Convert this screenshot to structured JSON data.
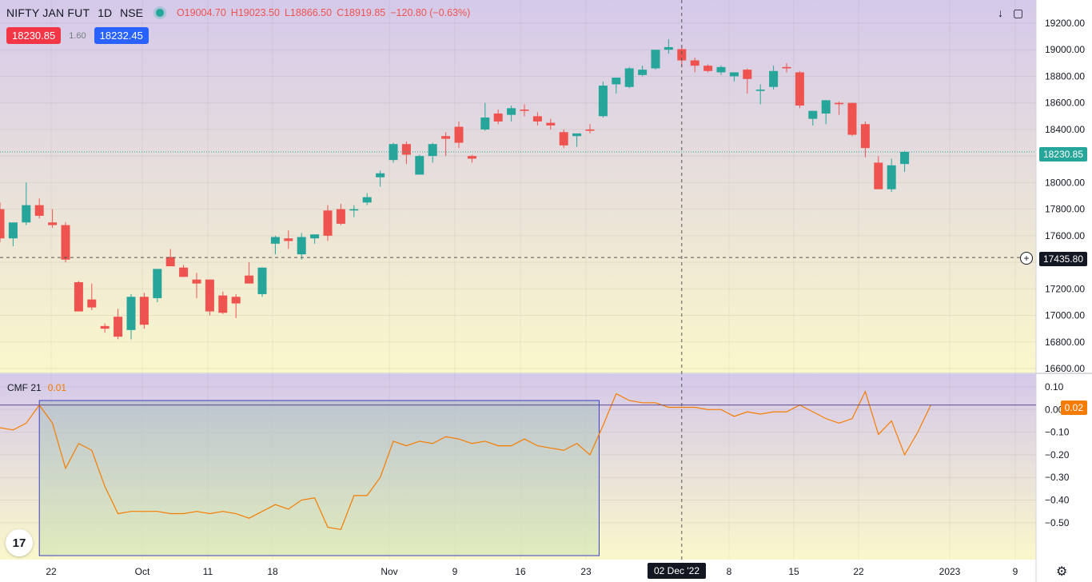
{
  "header": {
    "symbol": "NIFTY JAN FUT",
    "interval": "1D",
    "exchange": "NSE",
    "ohlc": {
      "o": "O19004.70",
      "h": "H19023.50",
      "l": "L18866.50",
      "c": "C18919.85",
      "chg": "−120.80 (−0.63%)"
    }
  },
  "quotes": {
    "sell": "18230.85",
    "spread": "1.60",
    "buy": "18232.45"
  },
  "icons": [
    "download-arrow-icon",
    "fullscreen-icon"
  ],
  "indicator": {
    "name": "CMF 21",
    "value": "0.01"
  },
  "price_tags": {
    "last": "18230.85",
    "crosshair": "17435.80",
    "cmf": "0.02"
  },
  "crosshair_date": "02 Dec '22",
  "logo_text": "17",
  "colors": {
    "up": "#26a69a",
    "down": "#ef5350",
    "cmf_line": "#f57c00",
    "selection": "#3f3fbf"
  },
  "chart_data": [
    {
      "type": "candlestick",
      "price_scale": {
        "min": 16600,
        "max": 19200,
        "ticks": [
          "19200.00",
          "19000.00",
          "18800.00",
          "18600.00",
          "18400.00",
          "18200.00",
          "18000.00",
          "17800.00",
          "17600.00",
          "17400.00",
          "17200.00",
          "17000.00",
          "16800.00",
          "16600.00"
        ]
      },
      "time_labels": [
        "22",
        "Oct",
        "11",
        "18",
        "Nov",
        "9",
        "16",
        "23",
        "8",
        "15",
        "22",
        "2023",
        "9"
      ],
      "last_price": 18230.85,
      "crosshair_price": 17435.8,
      "candles": [
        [
          17800,
          17850,
          17550,
          17580
        ],
        [
          17580,
          17680,
          17520,
          17700
        ],
        [
          17700,
          18000,
          17680,
          17830
        ],
        [
          17830,
          17880,
          17730,
          17750
        ],
        [
          17700,
          17800,
          17660,
          17680
        ],
        [
          17680,
          17700,
          17400,
          17420
        ],
        [
          17250,
          17260,
          17040,
          17030
        ],
        [
          17120,
          17240,
          17040,
          17060
        ],
        [
          16920,
          16940,
          16870,
          16900
        ],
        [
          16990,
          17050,
          16820,
          16840
        ],
        [
          16890,
          17160,
          16820,
          17140
        ],
        [
          17140,
          17170,
          16900,
          16930
        ],
        [
          17130,
          17200,
          17100,
          17350
        ],
        [
          17440,
          17500,
          17380,
          17370
        ],
        [
          17360,
          17380,
          17290,
          17290
        ],
        [
          17270,
          17320,
          17130,
          17240
        ],
        [
          17270,
          17270,
          17000,
          17030
        ],
        [
          17150,
          17180,
          17010,
          17020
        ],
        [
          17140,
          17160,
          16980,
          17090
        ],
        [
          17300,
          17400,
          17250,
          17240
        ],
        [
          17160,
          17360,
          17140,
          17360
        ],
        [
          17540,
          17600,
          17460,
          17590
        ],
        [
          17580,
          17640,
          17500,
          17560
        ],
        [
          17460,
          17620,
          17420,
          17590
        ],
        [
          17580,
          17600,
          17540,
          17610
        ],
        [
          17790,
          17830,
          17560,
          17600
        ],
        [
          17800,
          17840,
          17680,
          17690
        ],
        [
          17790,
          17830,
          17740,
          17800
        ],
        [
          17850,
          17920,
          17830,
          17890
        ],
        [
          18040,
          18090,
          17970,
          18070
        ],
        [
          18170,
          18300,
          18150,
          18290
        ],
        [
          18290,
          18310,
          18140,
          18210
        ],
        [
          18060,
          18210,
          18060,
          18200
        ],
        [
          18200,
          18300,
          18150,
          18290
        ],
        [
          18350,
          18380,
          18200,
          18330
        ],
        [
          18420,
          18460,
          18260,
          18300
        ],
        [
          18200,
          18210,
          18150,
          18180
        ],
        [
          18400,
          18600,
          18390,
          18490
        ],
        [
          18520,
          18550,
          18440,
          18460
        ],
        [
          18510,
          18580,
          18460,
          18560
        ],
        [
          18550,
          18590,
          18500,
          18540
        ],
        [
          18500,
          18530,
          18430,
          18460
        ],
        [
          18450,
          18480,
          18400,
          18430
        ],
        [
          18380,
          18400,
          18260,
          18280
        ],
        [
          18350,
          18350,
          18270,
          18370
        ],
        [
          18400,
          18440,
          18370,
          18390
        ],
        [
          18500,
          18760,
          18490,
          18730
        ],
        [
          18740,
          18790,
          18670,
          18790
        ],
        [
          18720,
          18870,
          18710,
          18860
        ],
        [
          18810,
          18880,
          18800,
          18850
        ],
        [
          18860,
          19000,
          18850,
          19000
        ],
        [
          19000,
          19080,
          18970,
          19020
        ],
        [
          19004.7,
          19023.5,
          18866.5,
          18919.85
        ],
        [
          18920,
          18940,
          18830,
          18880
        ],
        [
          18880,
          18890,
          18830,
          18840
        ],
        [
          18830,
          18880,
          18810,
          18870
        ],
        [
          18800,
          18830,
          18760,
          18830
        ],
        [
          18850,
          18860,
          18670,
          18780
        ],
        [
          18690,
          18740,
          18590,
          18700
        ],
        [
          18720,
          18880,
          18700,
          18840
        ],
        [
          18870,
          18900,
          18830,
          18860
        ],
        [
          18830,
          18840,
          18560,
          18580
        ],
        [
          18480,
          18520,
          18430,
          18540
        ],
        [
          18520,
          18620,
          18440,
          18620
        ],
        [
          18600,
          18610,
          18510,
          18590
        ],
        [
          18600,
          18600,
          18350,
          18360
        ],
        [
          18440,
          18460,
          18190,
          18260
        ],
        [
          18150,
          18200,
          17970,
          17950
        ],
        [
          17950,
          18180,
          17930,
          18130
        ],
        [
          18140,
          18240,
          18080,
          18230.85
        ]
      ]
    },
    {
      "type": "line",
      "name": "CMF 21",
      "y_scale": {
        "min": -0.55,
        "max": 0.1,
        "ticks": [
          "0.10",
          "0.00",
          "−0.10",
          "−0.20",
          "−0.30",
          "−0.40",
          "−0.50"
        ]
      },
      "current_value": 0.02,
      "values": [
        -0.08,
        -0.09,
        -0.06,
        0.02,
        -0.06,
        -0.26,
        -0.15,
        -0.18,
        -0.34,
        -0.46,
        -0.45,
        -0.45,
        -0.45,
        -0.46,
        -0.46,
        -0.45,
        -0.46,
        -0.45,
        -0.46,
        -0.48,
        -0.45,
        -0.42,
        -0.44,
        -0.4,
        -0.39,
        -0.52,
        -0.53,
        -0.38,
        -0.38,
        -0.3,
        -0.14,
        -0.16,
        -0.14,
        -0.15,
        -0.12,
        -0.13,
        -0.15,
        -0.14,
        -0.16,
        -0.16,
        -0.13,
        -0.16,
        -0.17,
        -0.18,
        -0.15,
        -0.2,
        -0.07,
        0.07,
        0.04,
        0.03,
        0.03,
        0.01,
        0.01,
        0.01,
        0.0,
        0.0,
        -0.03,
        -0.01,
        -0.02,
        -0.01,
        -0.01,
        0.02,
        -0.01,
        -0.04,
        -0.06,
        -0.04,
        0.08,
        -0.11,
        -0.05,
        -0.2,
        -0.1,
        0.02
      ]
    }
  ]
}
